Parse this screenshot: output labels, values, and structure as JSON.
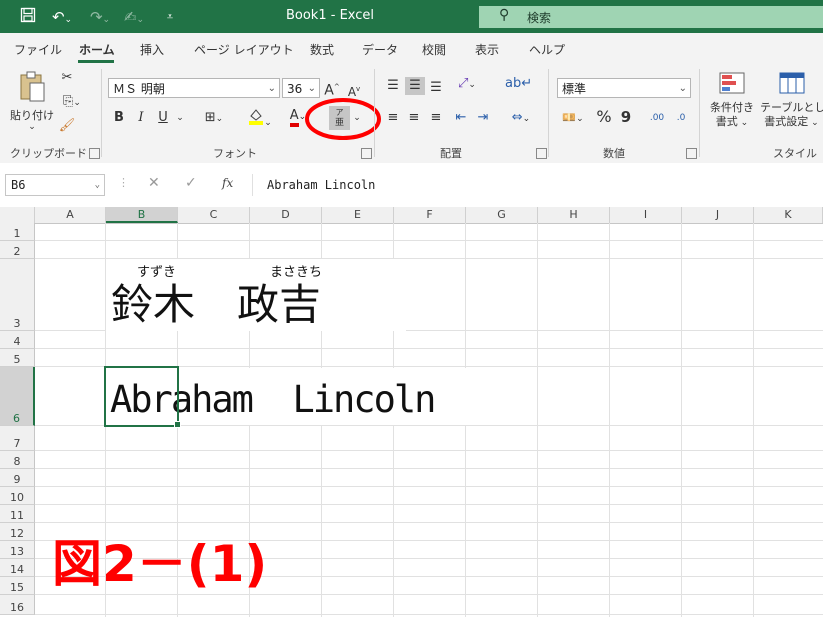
{
  "titlebar": {
    "title": "Book1  -  Excel",
    "search_placeholder": "検索",
    "icons": [
      "save-icon",
      "undo-icon",
      "redo-icon",
      "format-painter-icon",
      "customize-toolbar-icon",
      "search-icon"
    ]
  },
  "tabs": [
    "ファイル",
    "ホーム",
    "挿入",
    "ページ レイアウト",
    "数式",
    "データ",
    "校閲",
    "表示",
    "ヘルプ"
  ],
  "active_tab": "ホーム",
  "ribbon": {
    "clipboard": {
      "paste_label": "貼り付け",
      "group_label": "クリップボード"
    },
    "font": {
      "font_name": "ＭＳ 明朝",
      "font_size": "36",
      "bold": "B",
      "italic": "I",
      "underline": "U",
      "grow": "A",
      "shrink": "A",
      "phonetic_label_top": "ア",
      "phonetic_label_bottom": "亜",
      "group_label": "フォント"
    },
    "alignment": {
      "group_label": "配置"
    },
    "number": {
      "format": "標準",
      "percent": "%",
      "comma": "9",
      "inc_decimal": ".00",
      "dec_decimal": ".0",
      "group_label": "数値"
    },
    "styles": {
      "conditional_label_1": "条件付き",
      "conditional_label_2": "書式",
      "table_label_1": "テーブルとして",
      "table_label_2": "書式設定",
      "group_label": "スタイル"
    }
  },
  "formula_bar": {
    "name_box": "B6",
    "fx": "fx",
    "content": "Abraham  Lincoln"
  },
  "columns": [
    "A",
    "B",
    "C",
    "D",
    "E",
    "F",
    "G",
    "H",
    "I",
    "J",
    "K"
  ],
  "rows": [
    "1",
    "2",
    "3",
    "4",
    "5",
    "6",
    "7",
    "8",
    "9",
    "10",
    "11",
    "12",
    "13",
    "14",
    "15",
    "16"
  ],
  "cells": {
    "row3_furigana_1": "すずき",
    "row3_furigana_2": "まさきち",
    "row3_text": "鈴木　政吉",
    "row6_text": "Abraham  Lincoln"
  },
  "figure_label": "図2－(1)",
  "colors": {
    "accent": "#217346",
    "annotation": "#ff0000"
  }
}
